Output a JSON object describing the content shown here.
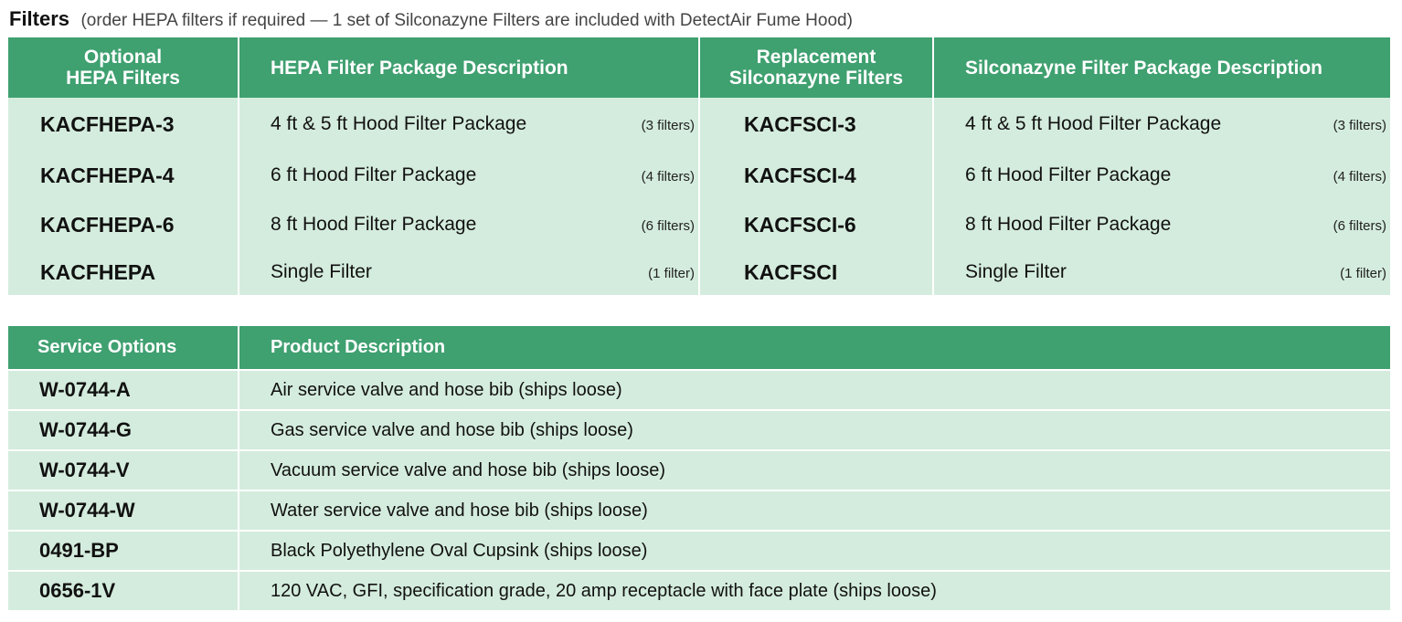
{
  "heading": {
    "title": "Filters",
    "subtitle": "(order HEPA filters if required — 1 set of Silconazyne Filters are included with DetectAir Fume Hood)"
  },
  "filters_table": {
    "headers": {
      "hepa_code_line1": "Optional",
      "hepa_code_line2": "HEPA Filters",
      "hepa_desc": "HEPA Filter Package Description",
      "sil_code_line1": "Replacement",
      "sil_code_line2": "Silconazyne Filters",
      "sil_desc": "Silconazyne Filter Package Description"
    },
    "rows": [
      {
        "hepa_code": "KACFHEPA-3",
        "hepa_desc": "4 ft & 5 ft Hood Filter Package",
        "hepa_count": "(3 filters)",
        "sil_code": "KACFSCI-3",
        "sil_desc": "4 ft & 5 ft Hood Filter Package",
        "sil_count": "(3 filters)"
      },
      {
        "hepa_code": "KACFHEPA-4",
        "hepa_desc": "6 ft Hood Filter Package",
        "hepa_count": "(4 filters)",
        "sil_code": "KACFSCI-4",
        "sil_desc": "6 ft Hood Filter Package",
        "sil_count": "(4 filters)"
      },
      {
        "hepa_code": "KACFHEPA-6",
        "hepa_desc": "8 ft Hood Filter Package",
        "hepa_count": "(6 filters)",
        "sil_code": "KACFSCI-6",
        "sil_desc": "8 ft Hood Filter Package",
        "sil_count": "(6 filters)"
      },
      {
        "hepa_code": "KACFHEPA",
        "hepa_desc": "Single Filter",
        "hepa_count": "(1 filter)",
        "sil_code": "KACFSCI",
        "sil_desc": "Single Filter",
        "sil_count": "(1 filter)"
      }
    ]
  },
  "service_table": {
    "headers": {
      "service": "Service Options",
      "product": "Product Description"
    },
    "rows": [
      {
        "code": "W-0744-A",
        "desc": "Air service valve and hose bib  (ships loose)"
      },
      {
        "code": "W-0744-G",
        "desc": "Gas service valve and hose bib  (ships loose)"
      },
      {
        "code": "W-0744-V",
        "desc": "Vacuum service valve and hose bib  (ships loose)"
      },
      {
        "code": "W-0744-W",
        "desc": "Water service valve and hose bib  (ships loose)"
      },
      {
        "code": "0491-BP",
        "desc": "Black Polyethylene Oval Cupsink  (ships loose)"
      },
      {
        "code": "0656-1V",
        "desc": "120 VAC, GFI, specification grade, 20 amp receptacle with face plate (ships loose)"
      }
    ]
  },
  "colors": {
    "header_green": "#3fa070",
    "row_mint": "#d4ecdd"
  }
}
